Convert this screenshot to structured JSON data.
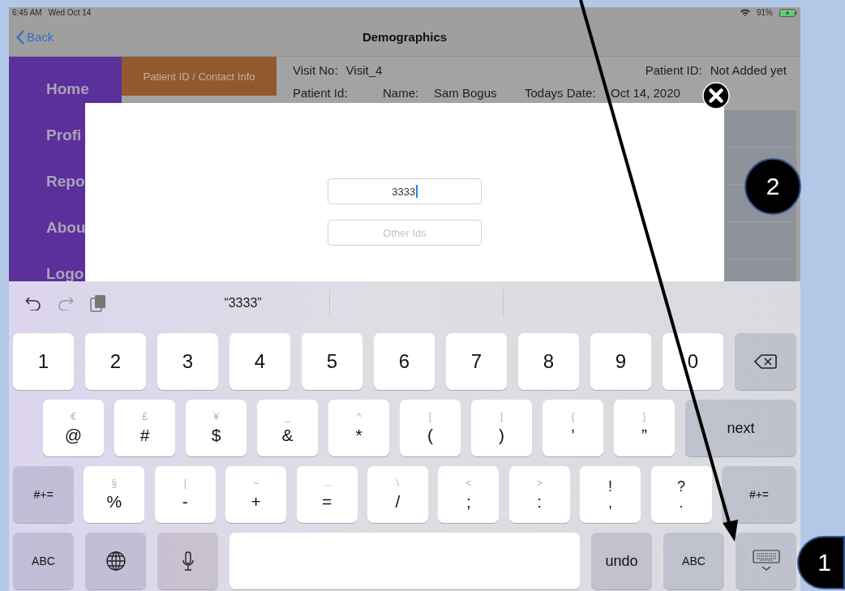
{
  "status_bar": {
    "time": "6:45 AM",
    "date": "Wed Oct 14",
    "battery": "91%"
  },
  "nav": {
    "back": "Back",
    "title": "Demographics"
  },
  "sidebar": {
    "items": [
      {
        "label": "Home"
      },
      {
        "label": "Profi"
      },
      {
        "label": "Repo"
      },
      {
        "label": "Abou"
      },
      {
        "label": "Logo"
      }
    ]
  },
  "tab": {
    "label": "Patient ID / Contact Info"
  },
  "header": {
    "visit_label": "Visit No:",
    "visit_value": "Visit_4",
    "patient_label": "Patient ID:",
    "patient_value": "Not Added yet",
    "line_2": [
      "Patient Id:",
      "Name:",
      "Sam Bogus",
      "Todays Date:",
      "Oct 14, 2020"
    ]
  },
  "modal": {
    "fields": [
      {
        "value": "3333",
        "focused": true
      },
      {
        "placeholder": "Other Ids",
        "focused": false
      }
    ]
  },
  "keyboard": {
    "suggestion": "“3333”",
    "rows": [
      {
        "keys": [
          {
            "kind": "char",
            "main": "1"
          },
          {
            "kind": "char",
            "main": "2"
          },
          {
            "kind": "char",
            "main": "3"
          },
          {
            "kind": "char",
            "main": "4"
          },
          {
            "kind": "char",
            "main": "5"
          },
          {
            "kind": "char",
            "main": "6"
          },
          {
            "kind": "char",
            "main": "7"
          },
          {
            "kind": "char",
            "main": "8"
          },
          {
            "kind": "char",
            "main": "9"
          },
          {
            "kind": "char",
            "main": "0"
          },
          {
            "kind": "delete"
          }
        ]
      },
      {
        "keys": [
          {
            "kind": "dual",
            "alt": "€",
            "main": "@"
          },
          {
            "kind": "dual",
            "alt": "£",
            "main": "#"
          },
          {
            "kind": "dual",
            "alt": "¥",
            "main": "$"
          },
          {
            "kind": "dual",
            "alt": "_",
            "main": "&"
          },
          {
            "kind": "dual",
            "alt": "^",
            "main": "*"
          },
          {
            "kind": "dual",
            "alt": "[",
            "main": "("
          },
          {
            "kind": "dual",
            "alt": "]",
            "main": ")"
          },
          {
            "kind": "dual",
            "alt": "{",
            "main": "’"
          },
          {
            "kind": "dual",
            "alt": "}",
            "main": "”"
          },
          {
            "kind": "action",
            "main": "next"
          }
        ]
      },
      {
        "keys": [
          {
            "kind": "action",
            "main": "#+="
          },
          {
            "kind": "dual",
            "alt": "§",
            "main": "%"
          },
          {
            "kind": "dual",
            "alt": "|",
            "main": "-"
          },
          {
            "kind": "dual",
            "alt": "~",
            "main": "+"
          },
          {
            "kind": "dual",
            "alt": "…",
            "main": "="
          },
          {
            "kind": "dual",
            "alt": "\\",
            "main": "/"
          },
          {
            "kind": "dual",
            "alt": "<",
            "main": ";"
          },
          {
            "kind": "dual",
            "alt": ">",
            "main": ":"
          },
          {
            "kind": "stack",
            "alt": "!",
            "main": ","
          },
          {
            "kind": "stack",
            "alt": "?",
            "main": "."
          },
          {
            "kind": "action",
            "main": "#+="
          }
        ]
      },
      {
        "keys": [
          {
            "kind": "action",
            "main": "ABC"
          },
          {
            "kind": "globe"
          },
          {
            "kind": "mic"
          },
          {
            "kind": "space"
          },
          {
            "kind": "action",
            "main": "undo"
          },
          {
            "kind": "action",
            "main": "ABC"
          },
          {
            "kind": "dismiss"
          }
        ]
      }
    ]
  },
  "callouts": [
    {
      "label": "2"
    },
    {
      "label": "1"
    }
  ]
}
